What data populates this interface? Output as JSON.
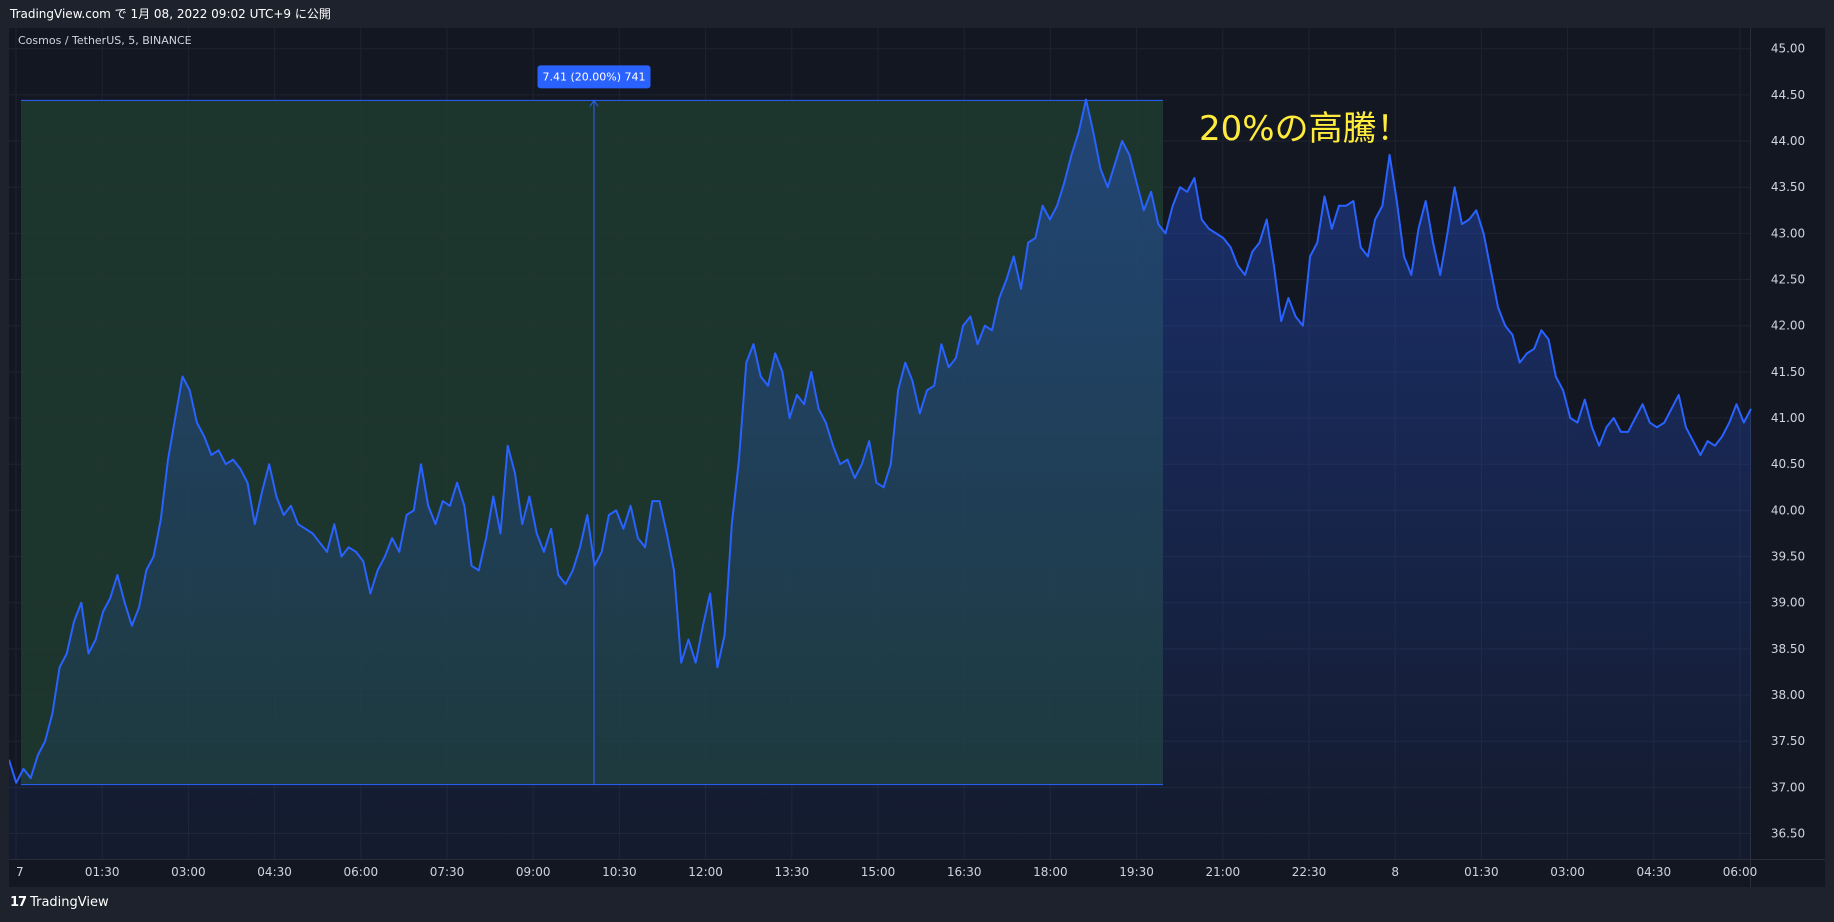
{
  "header": {
    "published": "TradingView.com で 1月 08, 2022 09:02 UTC+9 に公開"
  },
  "symbol": "Cosmos / TetherUS, 5, BINANCE",
  "footer": {
    "brand_mark": "17",
    "brand": "TradingView"
  },
  "colors": {
    "line": "#2962ff",
    "up_zone": "#1f3a2f",
    "annotation": "#ffeb3b",
    "label_bg": "#2962ff"
  },
  "annotation": "20%の高騰！",
  "measure": {
    "label": "7.41 (20.00%) 741",
    "from_value": 37.03,
    "to_value": 44.44
  },
  "chart_data": {
    "type": "area",
    "x_ticks": [
      "7",
      "01:30",
      "03:00",
      "04:30",
      "06:00",
      "07:30",
      "09:00",
      "10:30",
      "12:00",
      "13:30",
      "15:00",
      "16:30",
      "18:00",
      "19:30",
      "21:00",
      "22:30",
      "8",
      "01:30",
      "03:00",
      "04:30",
      "06:00"
    ],
    "y_ticks": [
      "45.00",
      "44.50",
      "44.00",
      "43.50",
      "43.00",
      "42.50",
      "42.00",
      "41.50",
      "41.00",
      "40.50",
      "40.00",
      "39.50",
      "39.00",
      "38.50",
      "38.00",
      "37.50",
      "37.00",
      "36.50"
    ],
    "ylim": [
      36.3,
      45.3
    ],
    "values": [
      37.3,
      37.05,
      37.2,
      37.1,
      37.35,
      37.5,
      37.8,
      38.3,
      38.45,
      38.8,
      39.0,
      38.45,
      38.6,
      38.9,
      39.05,
      39.3,
      39.0,
      38.75,
      38.95,
      39.35,
      39.5,
      39.9,
      40.55,
      41.0,
      41.45,
      41.3,
      40.95,
      40.8,
      40.6,
      40.65,
      40.5,
      40.55,
      40.45,
      40.3,
      39.85,
      40.2,
      40.5,
      40.15,
      39.95,
      40.05,
      39.85,
      39.8,
      39.75,
      39.65,
      39.55,
      39.85,
      39.5,
      39.6,
      39.55,
      39.45,
      39.1,
      39.35,
      39.5,
      39.7,
      39.55,
      39.95,
      40.0,
      40.5,
      40.05,
      39.85,
      40.1,
      40.05,
      40.3,
      40.05,
      39.4,
      39.35,
      39.7,
      40.15,
      39.75,
      40.7,
      40.4,
      39.85,
      40.15,
      39.75,
      39.55,
      39.8,
      39.3,
      39.2,
      39.35,
      39.6,
      39.95,
      39.4,
      39.55,
      39.95,
      40.0,
      39.8,
      40.05,
      39.7,
      39.6,
      40.1,
      40.1,
      39.75,
      39.35,
      38.35,
      38.6,
      38.35,
      38.75,
      39.1,
      38.3,
      38.65,
      39.85,
      40.55,
      41.6,
      41.8,
      41.45,
      41.35,
      41.7,
      41.5,
      41.0,
      41.25,
      41.15,
      41.5,
      41.1,
      40.95,
      40.7,
      40.5,
      40.55,
      40.35,
      40.5,
      40.75,
      40.3,
      40.25,
      40.5,
      41.3,
      41.6,
      41.4,
      41.05,
      41.3,
      41.35,
      41.8,
      41.55,
      41.65,
      42.0,
      42.1,
      41.8,
      42.0,
      41.95,
      42.3,
      42.5,
      42.75,
      42.4,
      42.9,
      42.95,
      43.3,
      43.15,
      43.3,
      43.55,
      43.85,
      44.1,
      44.45,
      44.1,
      43.7,
      43.5,
      43.75,
      44.0,
      43.85,
      43.55,
      43.25,
      43.45,
      43.1,
      43.0,
      43.3,
      43.5,
      43.45,
      43.6,
      43.15,
      43.05,
      43.0,
      42.95,
      42.85,
      42.65,
      42.55,
      42.8,
      42.9,
      43.15,
      42.65,
      42.05,
      42.3,
      42.1,
      42.0,
      42.75,
      42.9,
      43.4,
      43.05,
      43.3,
      43.3,
      43.35,
      42.85,
      42.75,
      43.15,
      43.3,
      43.85,
      43.35,
      42.75,
      42.55,
      43.05,
      43.35,
      42.9,
      42.55,
      43.0,
      43.5,
      43.1,
      43.15,
      43.25,
      43.0,
      42.6,
      42.2,
      42.0,
      41.9,
      41.6,
      41.7,
      41.75,
      41.95,
      41.85,
      41.45,
      41.3,
      41.0,
      40.95,
      41.2,
      40.9,
      40.7,
      40.9,
      41.0,
      40.85,
      40.85,
      41.0,
      41.15,
      40.95,
      40.9,
      40.95,
      41.1,
      41.25,
      40.9,
      40.75,
      40.6,
      40.75,
      40.7,
      40.8,
      40.95,
      41.15,
      40.95,
      41.1
    ]
  }
}
